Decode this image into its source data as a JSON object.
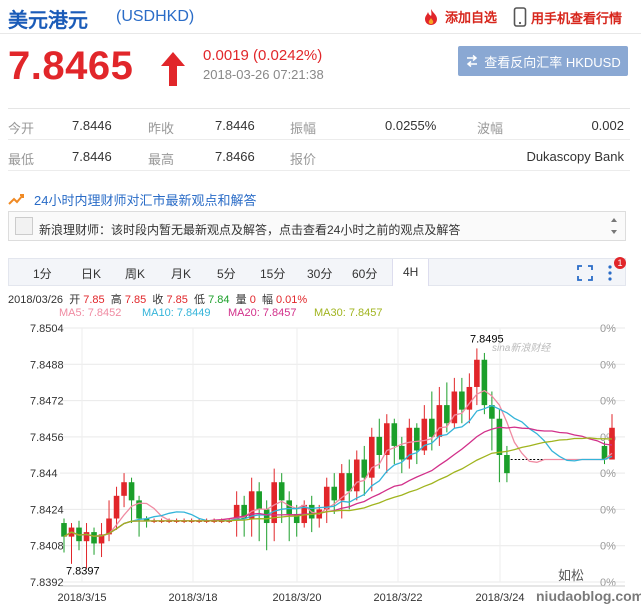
{
  "header": {
    "title": "美元港元",
    "code": "(USDHKD)",
    "add_watch": "添加自选",
    "mobile": "用手机查看行情"
  },
  "quote": {
    "price": "7.8465",
    "change": "0.0019 (0.0242%)",
    "timestamp": "2018-03-26 07:21:38",
    "reverse_button": "查看反向汇率 HKDUSD"
  },
  "stats": {
    "open_label": "今开",
    "open": "7.8446",
    "prev_label": "昨收",
    "prev": "7.8446",
    "amp_label": "振幅",
    "amp": "0.0255%",
    "wave_label": "波幅",
    "wave": "0.002",
    "low_label": "最低",
    "low": "7.8446",
    "high_label": "最高",
    "high": "7.8466",
    "quote_label": "报价",
    "source": "Dukascopy Bank"
  },
  "expert": {
    "heading": "24小时内理财师对汇市最新观点和解答",
    "message": "新浪理财师：该时段内暂无最新观点及解答，点击查看24小时之前的观点及解答"
  },
  "tabs": [
    "1分",
    "日K",
    "周K",
    "月K",
    "5分",
    "15分",
    "30分",
    "60分",
    "4H"
  ],
  "badge": "1",
  "bar_info": {
    "date": "2018/03/26",
    "open_l": "开",
    "open": "7.85",
    "high_l": "高",
    "high": "7.85",
    "close_l": "收",
    "close": "7.85",
    "low_l": "低",
    "low": "7.84",
    "vol_l": "量",
    "vol": "0",
    "amp_l": "幅",
    "amp": "0.01%"
  },
  "ma": {
    "ma5": "MA5: 7.8452",
    "ma10": "MA10: 7.8449",
    "ma20": "MA20: 7.8457",
    "ma30": "MA30: 7.8457"
  },
  "colors": {
    "up": "#e1262a",
    "down": "#1b9f2a",
    "ma5": "#f08ba2",
    "ma10": "#34b4d9",
    "ma20": "#d2308a",
    "ma30": "#a0b41e"
  },
  "watermarks": [
    "sina新浪财经",
    "如松",
    "niudaoblog.com"
  ],
  "chart_data": {
    "type": "candlestick",
    "y_ticks": [
      "7.8504",
      "7.8488",
      "7.8472",
      "7.8456",
      "7.844",
      "7.8424",
      "7.8408",
      "7.8392"
    ],
    "right_ticks": [
      "0%",
      "0%",
      "0%",
      "0%",
      "0%",
      "0%",
      "0%",
      "0%"
    ],
    "x_ticks": [
      "2018/3/15",
      "2018/3/18",
      "2018/3/20",
      "2018/3/22",
      "2018/3/24"
    ],
    "ylim": [
      7.8392,
      7.8504
    ],
    "annotations": [
      {
        "label": "7.8495",
        "value": 7.8495
      },
      {
        "label": "7.8397",
        "value": 7.8397
      }
    ],
    "candles": [
      [
        7.8418,
        7.8412,
        7.842,
        7.8405
      ],
      [
        7.8412,
        7.8416,
        7.8418,
        7.84
      ],
      [
        7.8416,
        7.841,
        7.8419,
        7.8406
      ],
      [
        7.841,
        7.8414,
        7.8418,
        7.8398
      ],
      [
        7.8414,
        7.8409,
        7.8416,
        7.8404
      ],
      [
        7.8409,
        7.8413,
        7.8418,
        7.8403
      ],
      [
        7.8413,
        7.842,
        7.8428,
        7.841
      ],
      [
        7.842,
        7.843,
        7.8434,
        7.8415
      ],
      [
        7.843,
        7.8436,
        7.844,
        7.8425
      ],
      [
        7.8436,
        7.8428,
        7.8438,
        7.8418
      ],
      [
        7.8428,
        7.842,
        7.843,
        7.8412
      ],
      [
        7.842,
        7.8419,
        7.8421,
        7.8416
      ],
      [
        7.8419,
        7.8419,
        7.842,
        7.8418
      ],
      [
        7.8419,
        7.8419,
        7.842,
        7.8418
      ],
      [
        7.8419,
        7.8419,
        7.842,
        7.8418
      ],
      [
        7.8419,
        7.8419,
        7.842,
        7.8418
      ],
      [
        7.8419,
        7.8419,
        7.842,
        7.8418
      ],
      [
        7.8419,
        7.8419,
        7.842,
        7.8418
      ],
      [
        7.8419,
        7.8419,
        7.842,
        7.8418
      ],
      [
        7.8419,
        7.8419,
        7.842,
        7.8418
      ],
      [
        7.8419,
        7.8419,
        7.842,
        7.8418
      ],
      [
        7.8419,
        7.8419,
        7.842,
        7.8418
      ],
      [
        7.8419,
        7.8419,
        7.842,
        7.8418
      ],
      [
        7.8419,
        7.8426,
        7.8432,
        7.8412
      ],
      [
        7.8426,
        7.842,
        7.843,
        7.8412
      ],
      [
        7.842,
        7.8432,
        7.8438,
        7.8412
      ],
      [
        7.8432,
        7.8424,
        7.8436,
        7.841
      ],
      [
        7.8424,
        7.8418,
        7.8428,
        7.8406
      ],
      [
        7.8418,
        7.8436,
        7.8442,
        7.841
      ],
      [
        7.8436,
        7.8428,
        7.844,
        7.8418
      ],
      [
        7.8428,
        7.8422,
        7.8432,
        7.841
      ],
      [
        7.8422,
        7.8418,
        7.8426,
        7.8412
      ],
      [
        7.8418,
        7.8426,
        7.8428,
        7.8416
      ],
      [
        7.8426,
        7.842,
        7.843,
        7.8414
      ],
      [
        7.842,
        7.8424,
        7.8426,
        7.8416
      ],
      [
        7.8424,
        7.8434,
        7.8438,
        7.8418
      ],
      [
        7.8434,
        7.8428,
        7.844,
        7.8422
      ],
      [
        7.8428,
        7.844,
        7.8444,
        7.842
      ],
      [
        7.844,
        7.8432,
        7.8446,
        7.8424
      ],
      [
        7.8432,
        7.8446,
        7.845,
        7.8428
      ],
      [
        7.8446,
        7.8438,
        7.8452,
        7.843
      ],
      [
        7.8438,
        7.8456,
        7.846,
        7.8432
      ],
      [
        7.8456,
        7.8448,
        7.8464,
        7.8442
      ],
      [
        7.8448,
        7.8462,
        7.8466,
        7.844
      ],
      [
        7.8462,
        7.8452,
        7.8464,
        7.8444
      ],
      [
        7.8452,
        7.8446,
        7.8456,
        7.844
      ],
      [
        7.8446,
        7.846,
        7.8464,
        7.8442
      ],
      [
        7.846,
        7.845,
        7.8462,
        7.8444
      ],
      [
        7.845,
        7.8464,
        7.847,
        7.8448
      ],
      [
        7.8464,
        7.8456,
        7.8476,
        7.845
      ],
      [
        7.8456,
        7.847,
        7.8478,
        7.8452
      ],
      [
        7.847,
        7.8462,
        7.848,
        7.8458
      ],
      [
        7.8462,
        7.8476,
        7.8482,
        7.846
      ],
      [
        7.8476,
        7.8468,
        7.8482,
        7.8462
      ],
      [
        7.8468,
        7.8478,
        7.8484,
        7.8462
      ],
      [
        7.8478,
        7.849,
        7.8495,
        7.847
      ],
      [
        7.849,
        7.847,
        7.8493,
        7.8466
      ],
      [
        7.847,
        7.8464,
        7.8476,
        7.845
      ],
      [
        7.8464,
        7.8448,
        7.8468,
        7.8436
      ],
      [
        7.8448,
        7.844,
        7.8452,
        7.8436
      ],
      [
        7.8446,
        7.8446,
        7.8446,
        7.8446
      ],
      [
        7.8446,
        7.8446,
        7.8446,
        7.8446
      ],
      [
        7.8446,
        7.8446,
        7.8446,
        7.8446
      ],
      [
        7.8446,
        7.8446,
        7.8446,
        7.8446
      ],
      [
        7.8446,
        7.8446,
        7.8446,
        7.8446
      ],
      [
        7.8446,
        7.8446,
        7.8446,
        7.8446
      ],
      [
        7.8446,
        7.8446,
        7.8446,
        7.8446
      ],
      [
        7.8446,
        7.8446,
        7.8446,
        7.8446
      ],
      [
        7.8446,
        7.8446,
        7.8446,
        7.8446
      ],
      [
        7.8446,
        7.8446,
        7.8446,
        7.8446
      ],
      [
        7.8446,
        7.8446,
        7.8446,
        7.8446
      ],
      [
        7.8446,
        7.8446,
        7.8446,
        7.8446
      ],
      [
        7.8452,
        7.8446,
        7.8454,
        7.8444
      ],
      [
        7.8446,
        7.846,
        7.8466,
        7.8446
      ]
    ]
  }
}
